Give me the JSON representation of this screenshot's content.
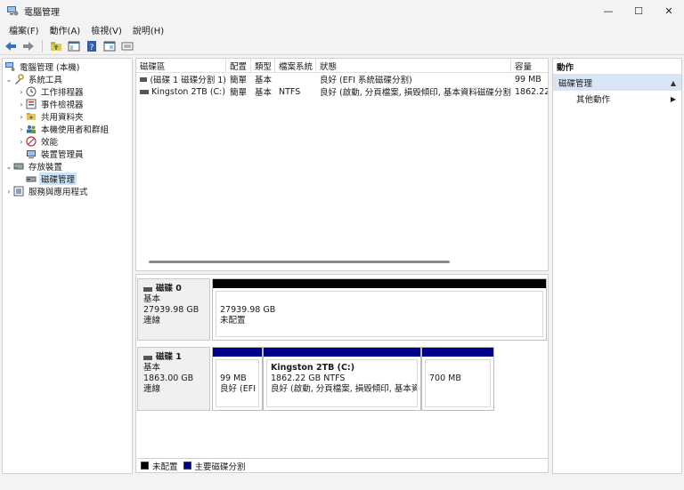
{
  "window": {
    "title": "電腦管理",
    "minimize": "—",
    "maximize": "☐",
    "close": "✕"
  },
  "menu": [
    "檔案(F)",
    "動作(A)",
    "檢視(V)",
    "說明(H)"
  ],
  "toolbar": {
    "icons": [
      "back-arrow-icon",
      "forward-arrow-icon",
      "up-folder-icon",
      "show-tree-icon",
      "help-icon",
      "properties-icon",
      "view-icon"
    ]
  },
  "tree": {
    "items": [
      {
        "label": "電腦管理 (本機)",
        "level": 0,
        "chevron": "",
        "icon": "computer-management-icon"
      },
      {
        "label": "系統工具",
        "level": 1,
        "chevron": "⌄",
        "icon": "tools-icon"
      },
      {
        "label": "工作排程器",
        "level": 2,
        "chevron": "›",
        "icon": "clock-icon"
      },
      {
        "label": "事件檢視器",
        "level": 2,
        "chevron": "›",
        "icon": "event-viewer-icon"
      },
      {
        "label": "共用資料夾",
        "level": 2,
        "chevron": "›",
        "icon": "shared-folder-icon"
      },
      {
        "label": "本機使用者和群組",
        "level": 2,
        "chevron": "›",
        "icon": "users-icon"
      },
      {
        "label": "效能",
        "level": 2,
        "chevron": "›",
        "icon": "performance-icon"
      },
      {
        "label": "裝置管理員",
        "level": 2,
        "chevron": "",
        "icon": "device-manager-icon"
      },
      {
        "label": "存放裝置",
        "level": 1,
        "chevron": "⌄",
        "icon": "storage-icon"
      },
      {
        "label": "磁碟管理",
        "level": 2,
        "chevron": "",
        "icon": "disk-management-icon",
        "selected": true
      },
      {
        "label": "服務與應用程式",
        "level": 1,
        "chevron": "›",
        "icon": "services-icon"
      }
    ]
  },
  "volumes": {
    "columns": [
      "磁碟區",
      "配置",
      "類型",
      "檔案系統",
      "狀態",
      "容量"
    ],
    "rows": [
      [
        "(磁碟 1 磁碟分割 1)",
        "簡單",
        "基本",
        "",
        "良好 (EFI 系統磁碟分割)",
        "99 MB"
      ],
      [
        "Kingston 2TB (C:)",
        "簡單",
        "基本",
        "NTFS",
        "良好 (啟動, 分頁檔案, 損毀傾印, 基本資料磁碟分割)",
        "1862.22"
      ]
    ]
  },
  "disks": [
    {
      "name": "磁碟 0",
      "type": "基本",
      "size": "27939.98 GB",
      "status": "連線",
      "partitions": [
        {
          "title": "",
          "size": "27939.98 GB",
          "status": "未配置",
          "kind": "unallocated"
        }
      ]
    },
    {
      "name": "磁碟 1",
      "type": "基本",
      "size": "1863.00 GB",
      "status": "連線",
      "partitions": [
        {
          "title": "",
          "size": "99 MB",
          "status": "良好 (EFI 系",
          "kind": "primary"
        },
        {
          "title": "Kingston 2TB  (C:)",
          "size": "1862.22 GB NTFS",
          "status": "良好 (啟動, 分頁檔案, 損毀傾印, 基本資料",
          "kind": "primary"
        },
        {
          "title": "",
          "size": "700 MB",
          "status": "",
          "kind": "primary"
        }
      ]
    }
  ],
  "legend": [
    {
      "label": "未配置",
      "color": "#000000"
    },
    {
      "label": "主要磁碟分割",
      "color": "#00008b"
    }
  ],
  "actions": {
    "header": "動作",
    "section": "磁碟管理",
    "items": [
      "其他動作"
    ]
  },
  "colors": {
    "unallocated": "#000000",
    "primary": "#00008b",
    "selection": "#cce4f7"
  }
}
